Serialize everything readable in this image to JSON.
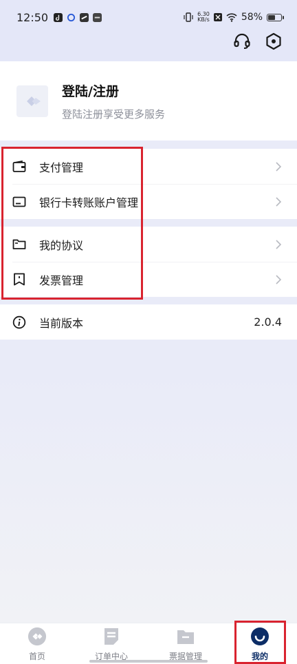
{
  "status_bar": {
    "time": "12:50",
    "net_speed_value": "6.30",
    "net_speed_unit": "KB/s",
    "battery": "58%"
  },
  "header": {
    "icons": [
      "headset-icon",
      "settings-hexagon-icon"
    ]
  },
  "profile": {
    "title": "登陆/注册",
    "subtitle": "登陆注册享受更多服务"
  },
  "menu": {
    "group1": [
      {
        "label": "支付管理",
        "icon": "wallet-icon"
      },
      {
        "label": "银行卡转账账户管理",
        "icon": "card-icon"
      }
    ],
    "group2": [
      {
        "label": "我的协议",
        "icon": "folder-icon"
      },
      {
        "label": "发票管理",
        "icon": "bookmark-icon"
      }
    ],
    "version": {
      "label": "当前版本",
      "value": "2.0.4",
      "icon": "info-icon"
    }
  },
  "tabbar": {
    "tabs": [
      {
        "label": "首页",
        "icon": "home-logo-icon"
      },
      {
        "label": "订单中心",
        "icon": "order-icon"
      },
      {
        "label": "票据管理",
        "icon": "ticket-folder-icon"
      },
      {
        "label": "我的",
        "icon": "profile-smile-icon"
      }
    ],
    "active_index": 3
  },
  "colors": {
    "accent": "#0c2d66",
    "highlight": "#d9232f",
    "header_bg": "#e4e7f8"
  }
}
